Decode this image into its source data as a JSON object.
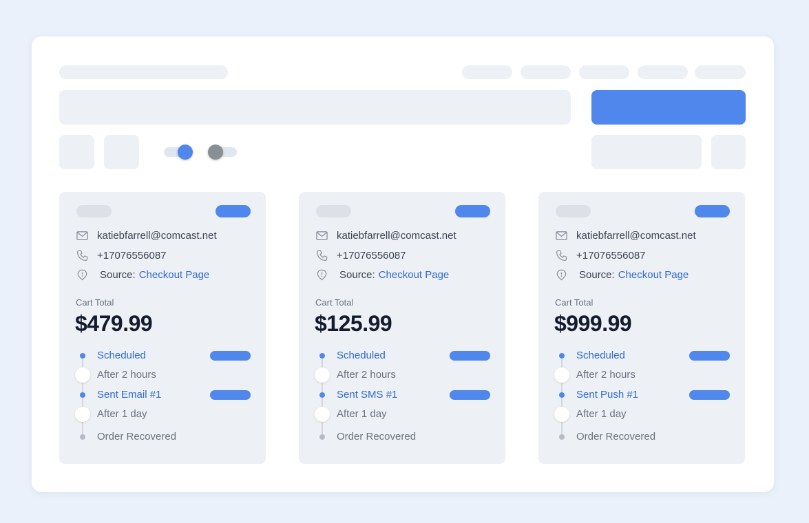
{
  "colors": {
    "accent": "#4f87ec",
    "link": "#2f6bd8",
    "background": "#eaf1fb",
    "placeholder": "#edf0f4"
  },
  "toggles": [
    {
      "state": "on"
    },
    {
      "state": "off"
    }
  ],
  "cards": [
    {
      "email": "katiebfarrell@comcast.net",
      "phone": "+17076556087",
      "source_label": "Source:",
      "source_link": "Checkout Page",
      "cart_label": "Cart Total",
      "cart_total": "$479.99",
      "timeline": {
        "step1": "Scheduled",
        "wait1": "After 2 hours",
        "step2": "Sent Email #1",
        "wait2": "After 1 day",
        "final": "Order Recovered"
      }
    },
    {
      "email": "katiebfarrell@comcast.net",
      "phone": "+17076556087",
      "source_label": "Source:",
      "source_link": "Checkout Page",
      "cart_label": "Cart Total",
      "cart_total": "$125.99",
      "timeline": {
        "step1": "Scheduled",
        "wait1": "After 2 hours",
        "step2": "Sent SMS #1",
        "wait2": "After 1 day",
        "final": "Order Recovered"
      }
    },
    {
      "email": "katiebfarrell@comcast.net",
      "phone": "+17076556087",
      "source_label": "Source:",
      "source_link": "Checkout Page",
      "cart_label": "Cart Total",
      "cart_total": "$999.99",
      "timeline": {
        "step1": "Scheduled",
        "wait1": "After 2 hours",
        "step2": "Sent Push #1",
        "wait2": "After 1 day",
        "final": "Order Recovered"
      }
    }
  ]
}
